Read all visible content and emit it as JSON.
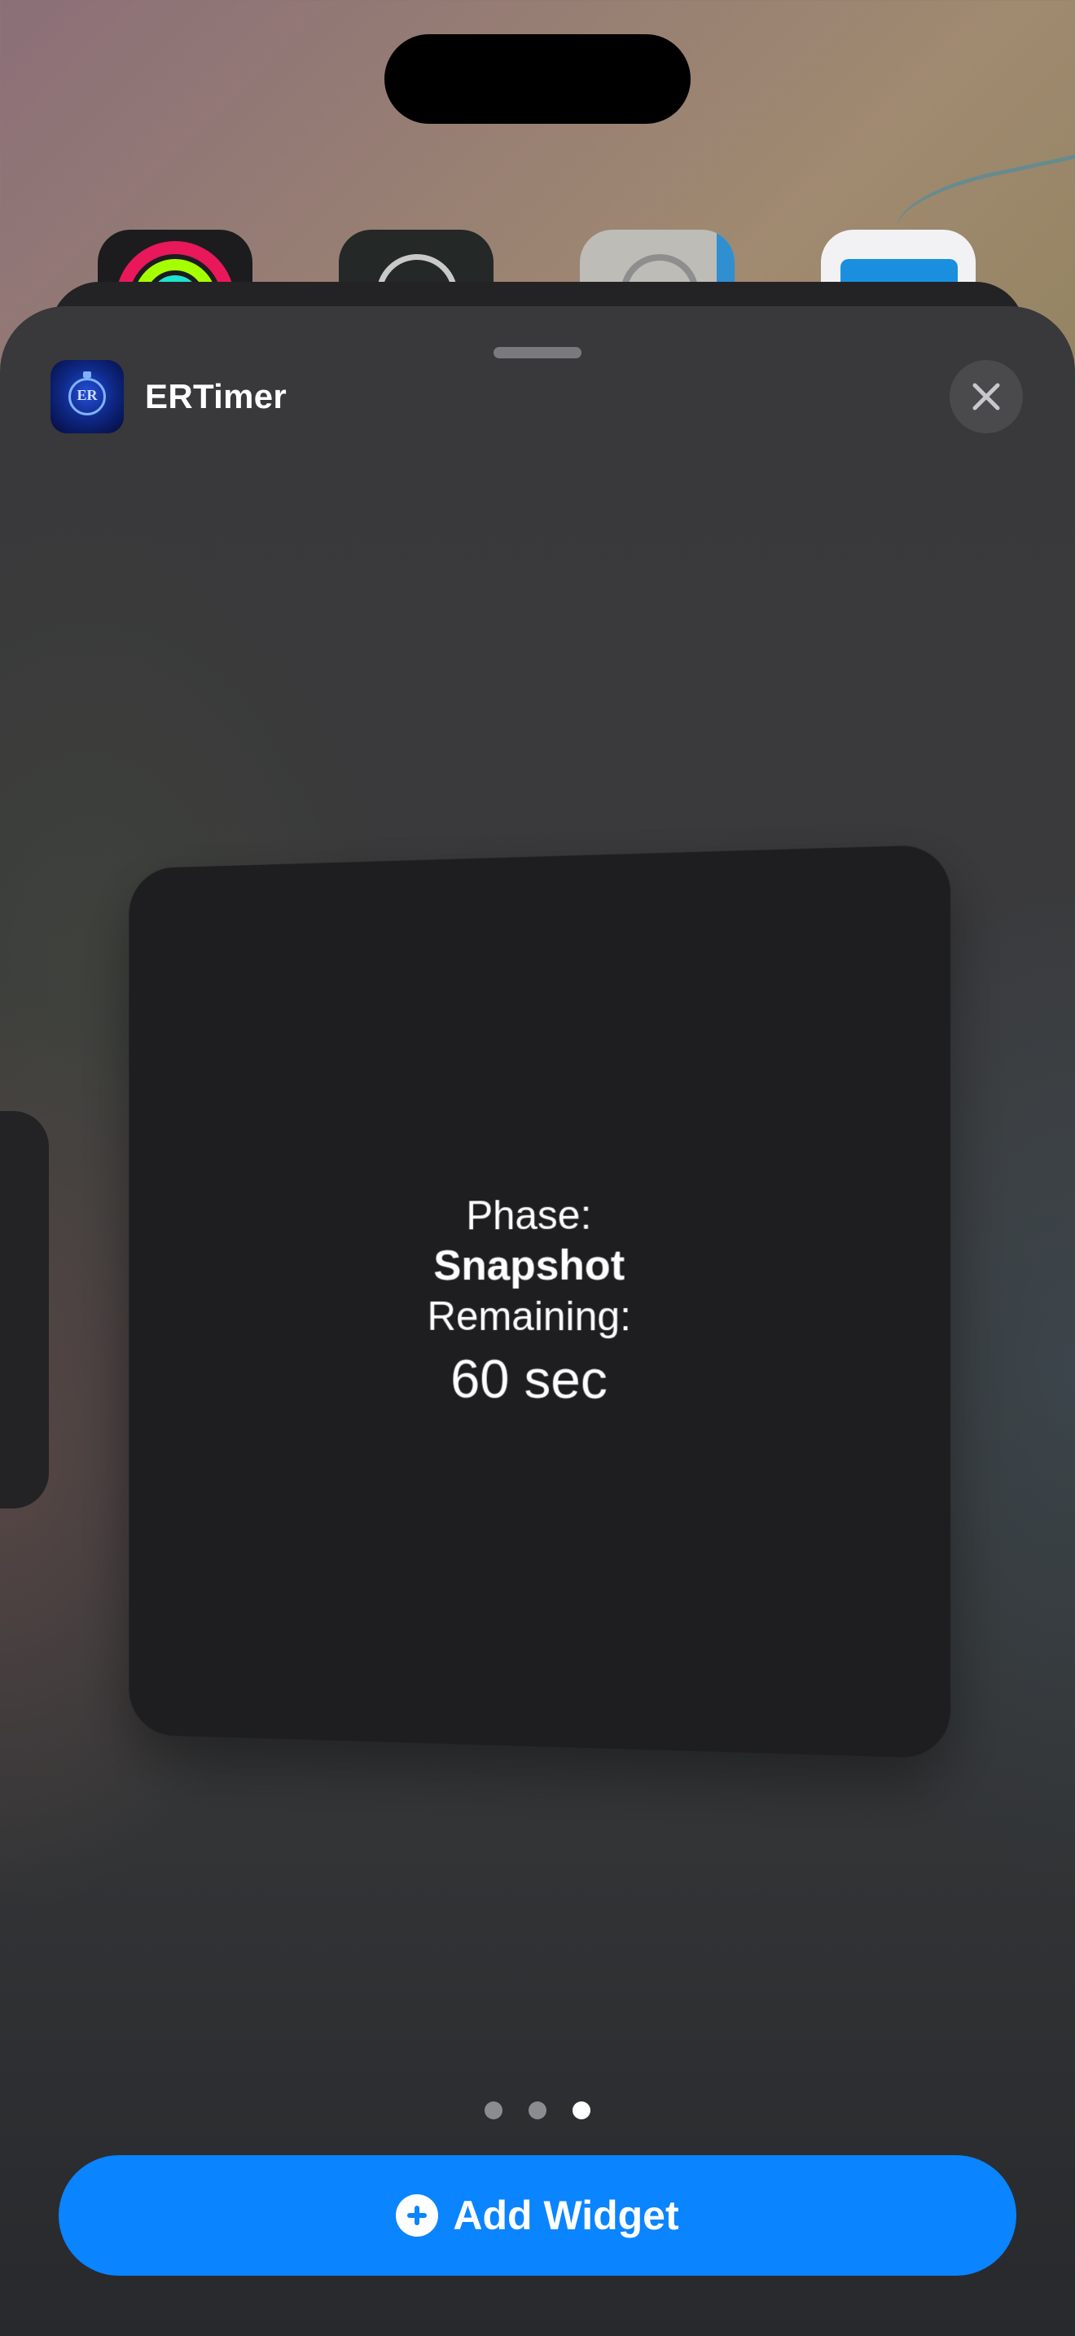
{
  "app": {
    "name": "ERTimer",
    "icon": "ertimer-app-icon",
    "icon_text": "ER"
  },
  "header": {
    "close_icon": "close-icon"
  },
  "widget": {
    "phase_label": "Phase:",
    "phase_value": "Snapshot",
    "remaining_label": "Remaining:",
    "remaining_value": "60 sec"
  },
  "pagination": {
    "total_pages": 3,
    "current_page": 3
  },
  "add_widget": {
    "label": "Add Widget",
    "icon": "plus-circle-icon"
  },
  "colors": {
    "accent": "#0a84ff",
    "sheet_background": "#3a3a3c",
    "widget_background": "#1e1e20"
  }
}
